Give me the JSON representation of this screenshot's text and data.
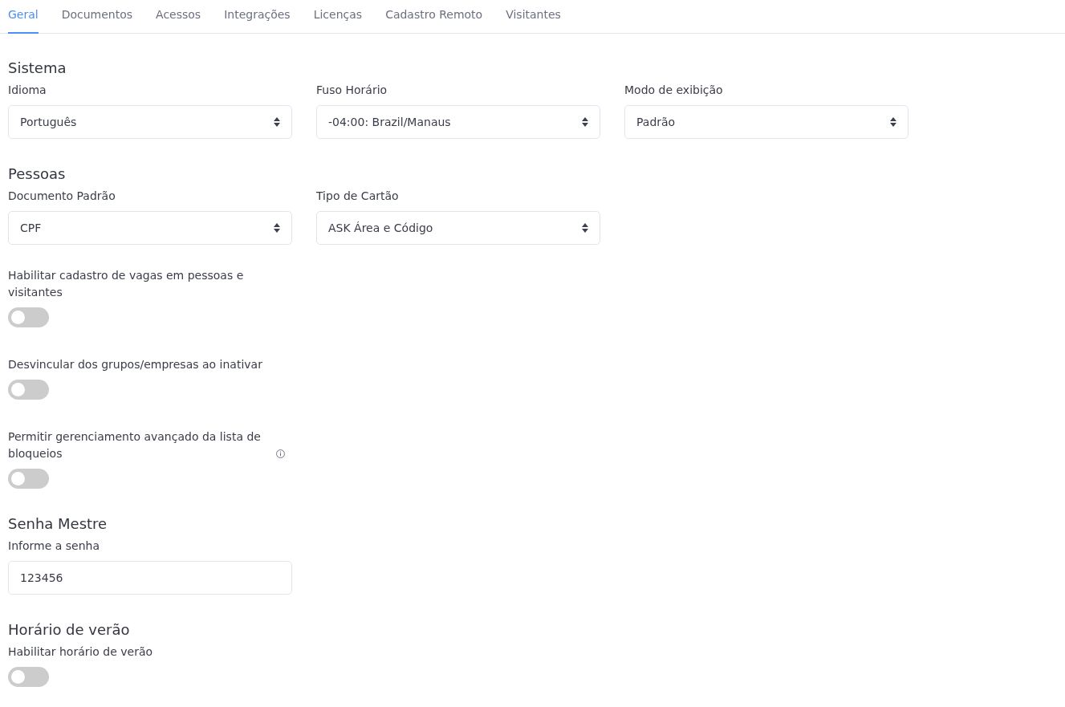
{
  "tabs": [
    {
      "label": "Geral",
      "selected": true
    },
    {
      "label": "Documentos",
      "selected": false
    },
    {
      "label": "Acessos",
      "selected": false
    },
    {
      "label": "Integrações",
      "selected": false
    },
    {
      "label": "Licenças",
      "selected": false
    },
    {
      "label": "Cadastro Remoto",
      "selected": false
    },
    {
      "label": "Visitantes",
      "selected": false
    }
  ],
  "sections": [
    {
      "title": "Sistema",
      "fields": [
        {
          "kind": "select",
          "label": "Idioma",
          "value": "Português"
        },
        {
          "kind": "select",
          "label": "Fuso Horário",
          "value": "-04:00: Brazil/Manaus"
        },
        {
          "kind": "select",
          "label": "Modo de exibição",
          "value": "Padrão"
        }
      ]
    },
    {
      "title": "Pessoas",
      "fields": [
        {
          "kind": "select",
          "label": "Documento Padrão",
          "value": "CPF"
        },
        {
          "kind": "select",
          "label": "Tipo de Cartão",
          "value": "ASK Área e Código"
        },
        {
          "kind": "toggle",
          "label": "Habilitar cadastro de vagas em pessoas e visitantes",
          "on": false,
          "info": false
        },
        {
          "kind": "toggle",
          "label": "Desvincular dos grupos/empresas ao inativar",
          "on": false,
          "info": false
        },
        {
          "kind": "toggle",
          "label": "Permitir gerenciamento avançado da lista de bloqueios",
          "on": false,
          "info": true
        }
      ]
    },
    {
      "title": "Senha Mestre",
      "fields": [
        {
          "kind": "text",
          "label": "Informe a senha",
          "value": "123456"
        }
      ]
    },
    {
      "title": "Horário de verão",
      "fields": [
        {
          "kind": "toggle",
          "label": "Habilitar horário de verão",
          "on": false,
          "info": false
        }
      ]
    }
  ]
}
